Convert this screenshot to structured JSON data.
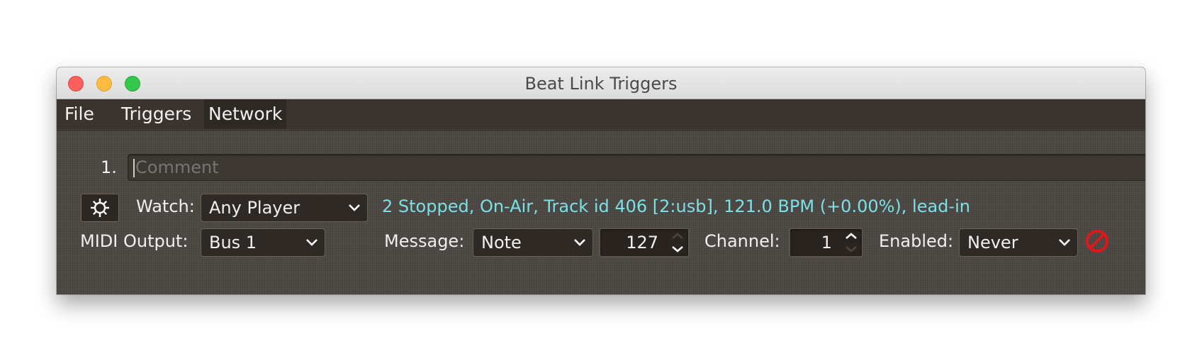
{
  "window": {
    "title": "Beat Link Triggers"
  },
  "menu": {
    "file": "File",
    "triggers": "Triggers",
    "network": "Network"
  },
  "trigger": {
    "index": "1.",
    "comment_placeholder": "Comment",
    "watch_label": "Watch:",
    "watch_value": "Any Player",
    "status": "2 Stopped, On-Air, Track id 406 [2:usb], 121.0 BPM (+0.00%), lead-in",
    "midi_output_label": "MIDI Output:",
    "midi_output_value": "Bus 1",
    "message_label": "Message:",
    "message_value": "Note",
    "note_value": "127",
    "channel_label": "Channel:",
    "channel_value": "1",
    "enabled_label": "Enabled:",
    "enabled_value": "Never"
  },
  "colors": {
    "status_text": "#7be0e6",
    "disabled_icon": "#e0161b",
    "menubar": "#3b332d",
    "panel": "#55504a"
  },
  "icons": {
    "gear": "gear-icon",
    "disabled": "disabled-icon",
    "dropdown": "chevron-down-icon"
  }
}
